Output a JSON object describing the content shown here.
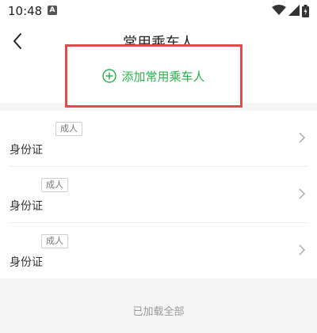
{
  "status_bar": {
    "time": "10:48",
    "notification_badge": "A",
    "icons": [
      "wifi-icon",
      "signal-icon",
      "battery-icon"
    ]
  },
  "nav": {
    "title": "常用乘车人",
    "back_icon": "chevron-left-icon"
  },
  "add_passenger": {
    "label": "添加常用乘车人",
    "icon": "plus-circle-icon",
    "accent_color": "#2bb24c",
    "highlight_color": "#e14b4b"
  },
  "passengers": [
    {
      "type_tag": "成人",
      "id_type": "身份证"
    },
    {
      "type_tag": "成人",
      "id_type": "身份证"
    },
    {
      "type_tag": "成人",
      "id_type": "身份证"
    }
  ],
  "footer": {
    "text": "已加载全部"
  }
}
